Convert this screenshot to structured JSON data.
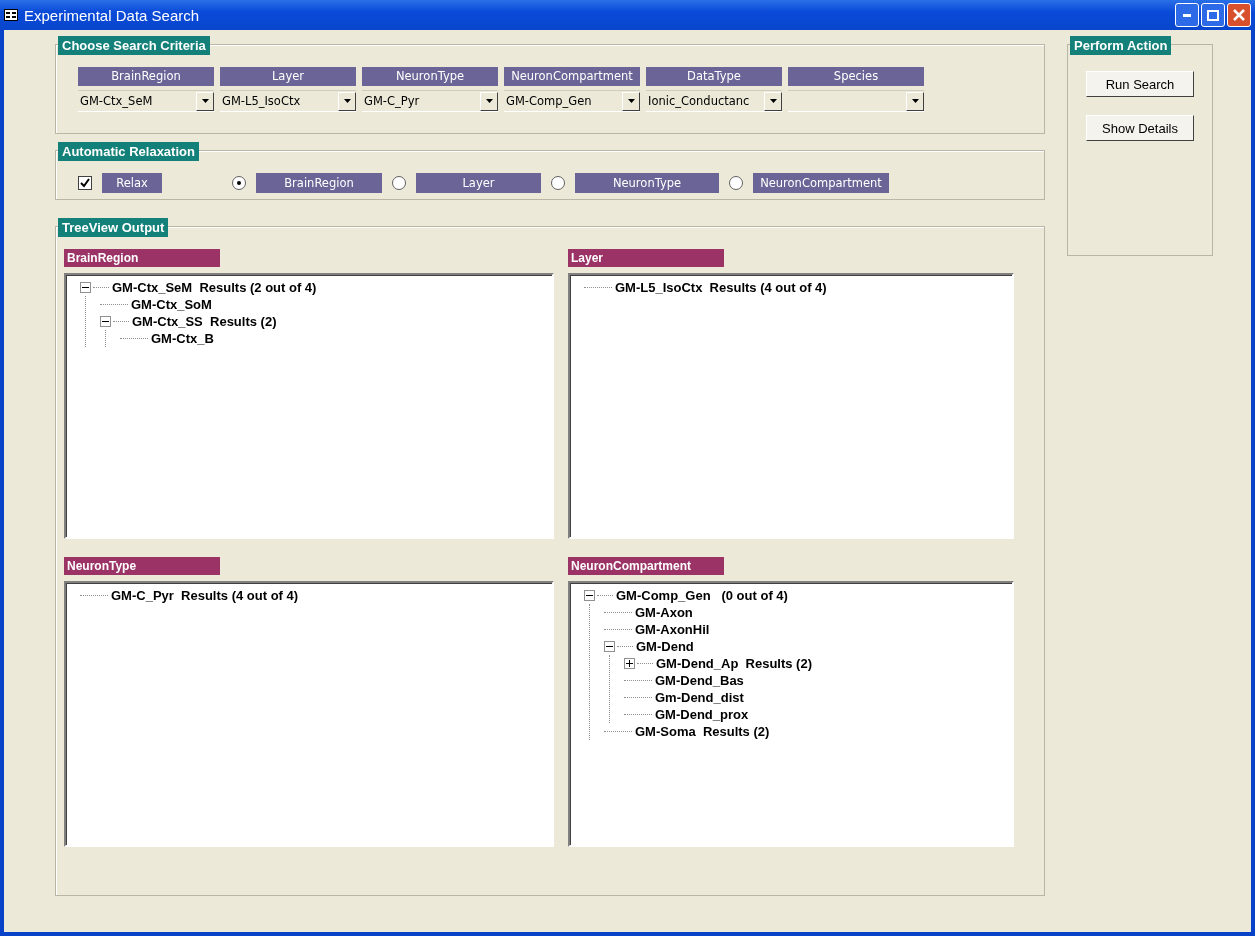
{
  "window": {
    "title": "Experimental Data Search"
  },
  "criteria": {
    "title": "Choose Search Criteria",
    "fields": [
      {
        "label": "BrainRegion",
        "value": "GM-Ctx_SeM"
      },
      {
        "label": "Layer",
        "value": "GM-L5_IsoCtx"
      },
      {
        "label": "NeuronType",
        "value": "GM-C_Pyr"
      },
      {
        "label": "NeuronCompartment",
        "value": "GM-Comp_Gen"
      },
      {
        "label": "DataType",
        "value": "Ionic_Conductanc"
      },
      {
        "label": "Species"
      }
    ]
  },
  "relaxation": {
    "title": "Automatic Relaxation",
    "relax": {
      "label": "Relax",
      "checked": true
    },
    "options": [
      {
        "label": "BrainRegion",
        "selected": true
      },
      {
        "label": "Layer",
        "selected": false
      },
      {
        "label": "NeuronType",
        "selected": false
      },
      {
        "label": "NeuronCompartment",
        "selected": false
      }
    ]
  },
  "actions": {
    "title": "Perform Action",
    "buttons": [
      "Run Search",
      "Show Details"
    ]
  },
  "treeview": {
    "title": "TreeView Output",
    "panels": [
      {
        "title": "BrainRegion",
        "nodes": [
          {
            "label": "GM-Ctx_SeM  Results (2 out of 4)",
            "expanded": true,
            "children": [
              {
                "label": "GM-Ctx_SoM"
              },
              {
                "label": "GM-Ctx_SS  Results (2)",
                "expanded": true,
                "children": [
                  {
                    "label": "GM-Ctx_B"
                  }
                ]
              }
            ]
          }
        ]
      },
      {
        "title": "Layer",
        "nodes": [
          {
            "label": "GM-L5_IsoCtx  Results (4 out of 4)"
          }
        ]
      },
      {
        "title": "NeuronType",
        "nodes": [
          {
            "label": "GM-C_Pyr  Results (4 out of 4)"
          }
        ]
      },
      {
        "title": "NeuronCompartment",
        "nodes": [
          {
            "label": "GM-Comp_Gen   (0 out of 4)",
            "expanded": true,
            "children": [
              {
                "label": "GM-Axon"
              },
              {
                "label": "GM-AxonHil"
              },
              {
                "label": "GM-Dend",
                "expanded": true,
                "children": [
                  {
                    "label": "GM-Dend_Ap  Results (2)",
                    "expanded": false
                  },
                  {
                    "label": "GM-Dend_Bas"
                  },
                  {
                    "label": "Gm-Dend_dist"
                  },
                  {
                    "label": "GM-Dend_prox"
                  }
                ]
              },
              {
                "label": "GM-Soma  Results (2)"
              }
            ]
          }
        ]
      }
    ]
  }
}
